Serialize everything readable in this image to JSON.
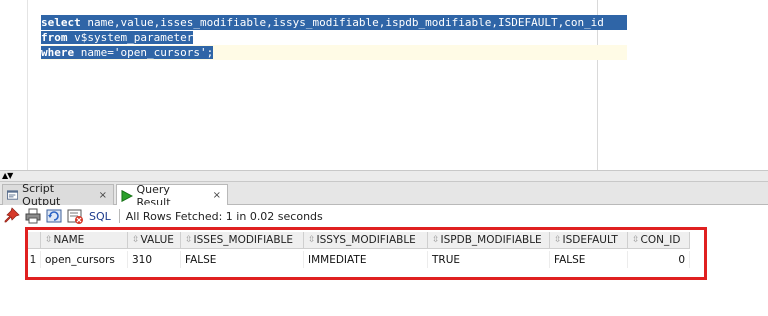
{
  "editor": {
    "line1_keyword": "select",
    "line1_rest": " name,value,isses_modifiable,issys_modifiable,ispdb_modifiable,ISDEFAULT,con_id",
    "line2_keyword": "from",
    "line2_rest": " v$system_parameter",
    "line3_keyword": "where",
    "line3_rest": " name=",
    "line3_string": "'open_cursors'",
    "line3_end": ";"
  },
  "tabs": [
    {
      "label": "Script Output",
      "icon": "script-output-icon",
      "active": false
    },
    {
      "label": "Query Result",
      "icon": "run-triangle-icon",
      "active": true
    }
  ],
  "tab_close_glyph": "×",
  "toolbar": {
    "icons": [
      "pin-icon",
      "print-icon",
      "refresh-icon",
      "export-icon"
    ],
    "sql_label": "SQL",
    "status": "All Rows Fetched: 1 in 0.02 seconds"
  },
  "grid": {
    "columns": [
      "NAME",
      "VALUE",
      "ISSES_MODIFIABLE",
      "ISSYS_MODIFIABLE",
      "ISPDB_MODIFIABLE",
      "ISDEFAULT",
      "CON_ID"
    ],
    "rows": [
      {
        "rownum": "1",
        "cells": [
          "open_cursors",
          "310",
          "FALSE",
          "IMMEDIATE",
          "TRUE",
          "FALSE",
          "0"
        ]
      }
    ]
  },
  "colors": {
    "selection": "#2f65a7",
    "highlight_box": "#e02020",
    "run_icon": "#2aa02a"
  }
}
